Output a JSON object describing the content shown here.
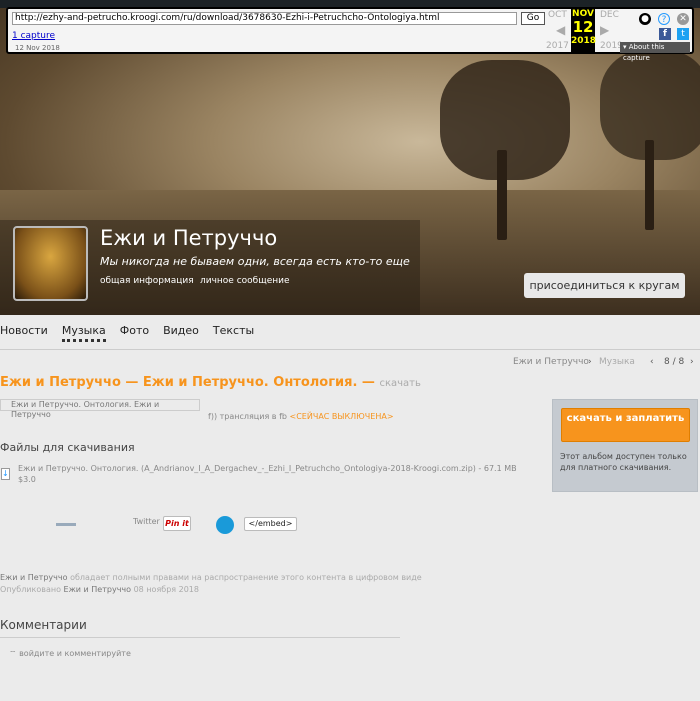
{
  "wayback": {
    "url": "http://ezhy-and-petrucho.kroogi.com/ru/download/3678630-Ezhi-i-Petruchcho-Ontologiya.html",
    "go": "Go",
    "captures": "1 capture",
    "capture_date": "12 Nov 2018",
    "prev_month": "OCT",
    "cur_month": "NOV",
    "next_month": "DEC",
    "day": "12",
    "prev_year": "2017",
    "cur_year": "2018",
    "next_year": "2019",
    "about": "About this capture"
  },
  "profile": {
    "name": "Ежи и Петруччо",
    "motto": "Мы никогда не бываем одни, всегда есть кто-то еще",
    "info_link": "общая информация",
    "message_link": "личное сообщение",
    "join": "присоединиться к кругам"
  },
  "tabs": [
    "Новости",
    "Музыка",
    "Фото",
    "Видео",
    "Тексты"
  ],
  "breadcrumb": {
    "artist": "Ежи и Петруччо",
    "section": "Музыка",
    "pager": "8 / 8"
  },
  "album": {
    "title": "Ежи и Петруччо — Ежи и Петруччо. Онтология. —",
    "download": "скачать",
    "image_alt": "Ежи и Петруччо. Онтология. Ежи и Петруччо",
    "broadcast": "трансляция в fb",
    "broadcast_status": "<СЕЙЧАС ВЫКЛЮЧЕНА>"
  },
  "files": {
    "heading": "Файлы для скачивания",
    "file": "Ежи и Петруччо. Онтология. (A_Andrianov_I_A_Dergachev_-_Ezhi_I_Petruchcho_Ontologiya-2018-Kroogi.com.zip) - 67.1 MB",
    "price": "$3.0"
  },
  "share": {
    "twitter": "Twitter",
    "pinit": "Pin it",
    "embed": "</embed>"
  },
  "side": {
    "buy": "скачать и заплатить",
    "note": "Этот альбом доступен только для платного скачивания."
  },
  "rights": {
    "owner": "Ежи и Петруччо",
    "text": "обладает полными правами на распространение этого контента в цифровом виде",
    "published": "Опубликовано",
    "author": "Ежи и Петруччо",
    "date": "08 ноября 2018"
  },
  "comments": {
    "heading": "Комментарии",
    "login": "войдите и комментируйте"
  }
}
